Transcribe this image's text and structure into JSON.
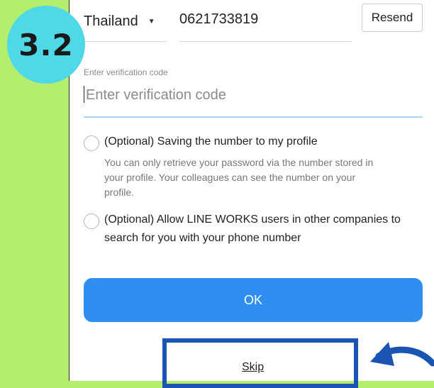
{
  "step_badge": "3.2",
  "country": {
    "name": "Thailand"
  },
  "phone": {
    "number": "0621733819"
  },
  "resend_label": "Resend",
  "verification": {
    "label": "Enter verification code",
    "placeholder": "Enter verification code",
    "value": ""
  },
  "options": [
    {
      "title": "(Optional) Saving the number to my profile",
      "description_lines": [
        "You can only retrieve your password via the number stored in",
        "your profile. Your colleagues can see the number on your",
        "profile."
      ],
      "checked": false
    },
    {
      "title_lines": [
        "(Optional) Allow LINE WORKS users in other companies to",
        "search for you with your phone number"
      ],
      "checked": false
    }
  ],
  "ok_label": "OK",
  "skip_label": "Skip",
  "colors": {
    "background": "#b3ef6c",
    "badge": "#4fd8e6",
    "ok_button": "#2f8ff1",
    "highlight_box": "#1b55b4",
    "input_underline_active": "#a9d4f5"
  },
  "icons": [
    "chevron-down-icon",
    "curved-arrow-icon"
  ]
}
